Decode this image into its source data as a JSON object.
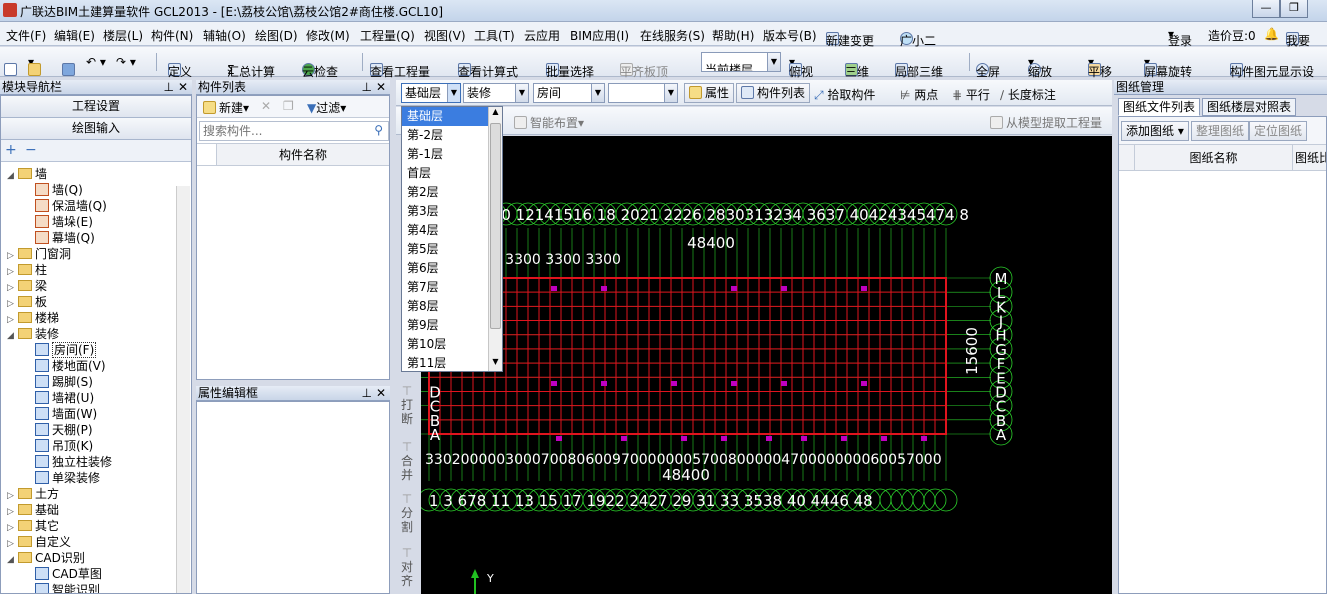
{
  "window": {
    "title": "广联达BIM土建算量软件 GCL2013 - [E:\\荔枝公馆\\荔枝公馆2#商住楼.GCL10]",
    "min": "—",
    "restore": "❐"
  },
  "menu": [
    "文件(F)",
    "编辑(E)",
    "楼层(L)",
    "构件(N)",
    "辅轴(O)",
    "绘图(D)",
    "修改(M)",
    "工程量(Q)",
    "视图(V)",
    "工具(T)",
    "云应用",
    "BIM应用(I)",
    "在线服务(S)",
    "帮助(H)",
    "版本号(B)",
    "新建变更",
    "广小二"
  ],
  "menu_right": {
    "login": "登录",
    "price_beans": "造价豆:0",
    "want": "我要"
  },
  "toolbar": {
    "define": "定义",
    "summary": "汇总计算",
    "cloud_check": "云检查",
    "view_qty": "查看工程量",
    "view_formula": "查看计算式",
    "batch_select": "批量选择",
    "align_slab": "平齐板顶",
    "current_floor": "当前楼层",
    "top_view": "俯视",
    "three_d": "三维",
    "local_3d": "局部三维",
    "fullscreen": "全屏",
    "zoom": "缩放",
    "pan": "平移",
    "rotate": "屏幕旋转",
    "display": "构件图元显示设"
  },
  "nav": {
    "title": "模块导航栏",
    "project_settings": "工程设置",
    "drawing_input": "绘图输入",
    "tree": [
      {
        "label": "墙",
        "type": "folder",
        "open": true
      },
      {
        "label": "墙(Q)",
        "type": "leaf"
      },
      {
        "label": "保温墙(Q)",
        "type": "leaf"
      },
      {
        "label": "墙垛(E)",
        "type": "leaf"
      },
      {
        "label": "幕墙(Q)",
        "type": "leaf"
      },
      {
        "label": "门窗洞",
        "type": "folder"
      },
      {
        "label": "柱",
        "type": "folder"
      },
      {
        "label": "梁",
        "type": "folder"
      },
      {
        "label": "板",
        "type": "folder"
      },
      {
        "label": "楼梯",
        "type": "folder"
      },
      {
        "label": "装修",
        "type": "folder",
        "open": true
      },
      {
        "label": "房间(F)",
        "type": "leafb",
        "selected": true
      },
      {
        "label": "楼地面(V)",
        "type": "leafb"
      },
      {
        "label": "踢脚(S)",
        "type": "leafb"
      },
      {
        "label": "墙裙(U)",
        "type": "leafb"
      },
      {
        "label": "墙面(W)",
        "type": "leafb"
      },
      {
        "label": "天棚(P)",
        "type": "leafb"
      },
      {
        "label": "吊顶(K)",
        "type": "leafb"
      },
      {
        "label": "独立柱装修",
        "type": "leafb"
      },
      {
        "label": "单梁装修",
        "type": "leafb"
      },
      {
        "label": "土方",
        "type": "folder"
      },
      {
        "label": "基础",
        "type": "folder"
      },
      {
        "label": "其它",
        "type": "folder"
      },
      {
        "label": "自定义",
        "type": "folder"
      },
      {
        "label": "CAD识别",
        "type": "folder",
        "open": true
      },
      {
        "label": "CAD草图",
        "type": "leafb"
      },
      {
        "label": "智能识别",
        "type": "leafb"
      }
    ]
  },
  "component_list": {
    "title": "构件列表",
    "new": "新建",
    "filter": "过滤",
    "search_placeholder": "搜索构件...",
    "col_name": "构件名称"
  },
  "property_panel": {
    "title": "属性编辑框"
  },
  "drawing_toolbar": {
    "floor": "基础层",
    "category": "装修",
    "type": "房间",
    "attr": "属性",
    "comp_list": "构件列表",
    "pick": "拾取构件",
    "two_point": "两点",
    "parallel": "平行",
    "dim": "长度标注",
    "smart_layout": "智能布置",
    "extract_qty": "从模型提取工程量"
  },
  "floor_dropdown": [
    "基础层",
    "第-2层",
    "第-1层",
    "首层",
    "第2层",
    "第3层",
    "第4层",
    "第5层",
    "第6层",
    "第7层",
    "第8层",
    "第9层",
    "第10层",
    "第11层"
  ],
  "side_tools": [
    "打断",
    "合并",
    "分割",
    "对齐"
  ],
  "drawing_mgmt": {
    "title": "图纸管理",
    "tab_files": "图纸文件列表",
    "tab_floors": "图纸楼层对照表",
    "add": "添加图纸",
    "organize": "整理图纸",
    "locate": "定位图纸",
    "col_name": "图纸名称",
    "col_ratio": "图纸比"
  },
  "canvas": {
    "top_axes": "1 3 5 7 910   12141516 18    2021 2226   2830313234   3637 40424345474 8",
    "bottom_axes": "1  3  678 11  13  15  17  1922 2427  29  31  33  3538 40  4446 48",
    "dim_top": "48400",
    "dim_bottom": "48400",
    "dim_side": "15600",
    "row_axes": [
      "M",
      "L",
      "K",
      "J",
      "H",
      "G",
      "F",
      "E",
      "D",
      "C",
      "B",
      "A"
    ],
    "row_axes_left": [
      "D",
      "C",
      "B",
      "A"
    ],
    "dim_top_row": "3300 3300 3300 3300 3300",
    "dim_bottom_row": "3302000003000700806009700000005700800000470000000060057000",
    "ucs_y": "Y"
  }
}
